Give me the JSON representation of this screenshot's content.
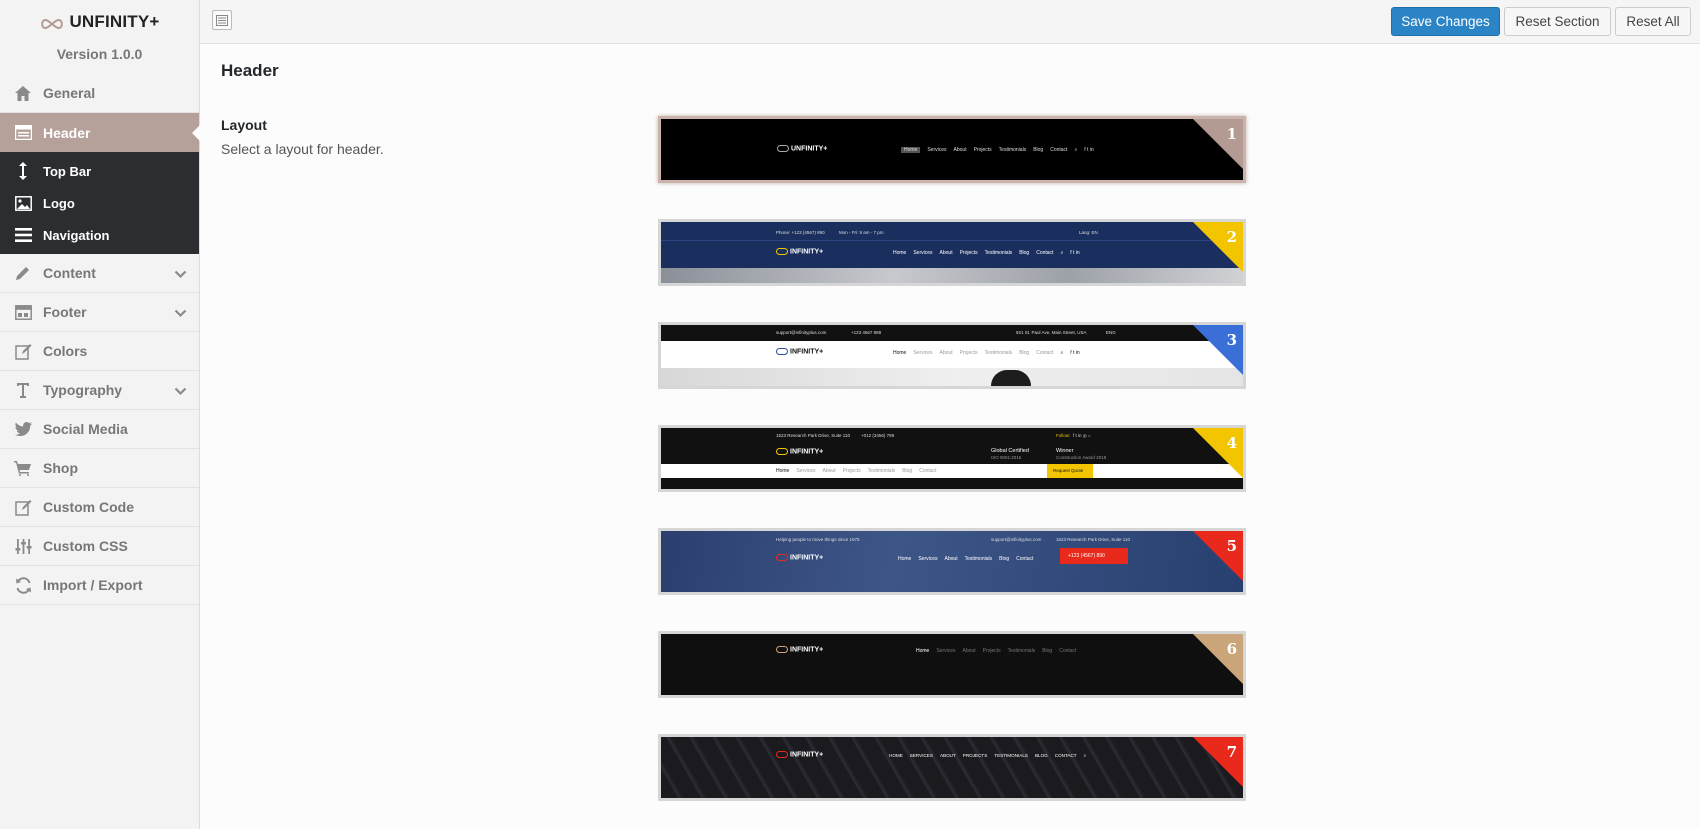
{
  "app": {
    "brand": "UNFINITY+",
    "version": "Version 1.0.0"
  },
  "sidebar": {
    "items": [
      {
        "label": "General",
        "icon": "home-icon"
      },
      {
        "label": "Header",
        "icon": "header-layout-icon",
        "active": true
      },
      {
        "label": "Content",
        "icon": "pencil-icon",
        "expandable": true
      },
      {
        "label": "Footer",
        "icon": "footer-layout-icon",
        "expandable": true
      },
      {
        "label": "Colors",
        "icon": "edit-square-icon"
      },
      {
        "label": "Typography",
        "icon": "text-icon",
        "expandable": true
      },
      {
        "label": "Social Media",
        "icon": "twitter-icon"
      },
      {
        "label": "Shop",
        "icon": "cart-icon"
      },
      {
        "label": "Custom Code",
        "icon": "edit-code-icon"
      },
      {
        "label": "Custom CSS",
        "icon": "sliders-icon"
      },
      {
        "label": "Import / Export",
        "icon": "refresh-icon"
      }
    ],
    "submenu": [
      {
        "label": "Top Bar",
        "icon": "vertical-arrows-icon"
      },
      {
        "label": "Logo",
        "icon": "image-icon"
      },
      {
        "label": "Navigation",
        "icon": "menu-lines-icon"
      }
    ]
  },
  "toolbar": {
    "save_label": "Save Changes",
    "reset_section_label": "Reset Section",
    "reset_all_label": "Reset All"
  },
  "section": {
    "title": "Header",
    "field_title": "Layout",
    "field_desc": "Select a layout for header."
  },
  "layouts": [
    {
      "number": "1",
      "corner_color": "#b39a92",
      "selected": true,
      "logo": "UNFINITY+",
      "nav": [
        "Home",
        "Services",
        "About",
        "Projects",
        "Testimonials",
        "Blog",
        "Contact"
      ]
    },
    {
      "number": "2",
      "corner_color": "#f2c500",
      "selected": false,
      "logo": "INFINITY+",
      "nav": [
        "Home",
        "Services",
        "About",
        "Projects",
        "Testimonials",
        "Blog",
        "Contact"
      ],
      "top_left": "Phone: +123 (4567) 890",
      "top_mid": "Mon - Fri: 9 am - 7 pm",
      "top_right": "Lang: EN"
    },
    {
      "number": "3",
      "corner_color": "#3a6fd8",
      "selected": false,
      "logo": "INFINITY+",
      "nav": [
        "Home",
        "Services",
        "About",
        "Projects",
        "Testimonials",
        "Blog",
        "Contact"
      ],
      "top_left": "support@infinityplus.com",
      "top_mid": "+123 4567 889",
      "top_right": "921 St. Paul Ave, Main Street, USA",
      "top_lang": "ENG"
    },
    {
      "number": "4",
      "corner_color": "#f2c500",
      "selected": false,
      "logo": "INFINITY+",
      "nav": [
        "Home",
        "Services",
        "About",
        "Projects",
        "Testimonials",
        "Blog",
        "Contact"
      ],
      "top_left": "1523 Research Park Drive, Suite 110",
      "top_mid": "+012 (3456) 789",
      "follow": "Follow:",
      "award1": "Global Certified",
      "award1_sub": "ISO 9001:2015",
      "award2": "Winner",
      "award2_sub": "Construction Award 2019",
      "cta": "Request Quote"
    },
    {
      "number": "5",
      "corner_color": "#e8291c",
      "selected": false,
      "logo": "INFINITY+",
      "nav": [
        "Home",
        "Services",
        "About",
        "Testimonials",
        "Blog",
        "Contact"
      ],
      "top_left": "Helping people to move things since 1975",
      "top_mid": "support@infinityplus.com",
      "top_right": "1523 Research Park Drive, Suite 110",
      "phone": "+123 (4567) 890"
    },
    {
      "number": "6",
      "corner_color": "#caa57a",
      "selected": false,
      "logo": "INFINITY+",
      "nav": [
        "Home",
        "Services",
        "About",
        "Projects",
        "Testimonials",
        "Blog",
        "Contact"
      ]
    },
    {
      "number": "7",
      "corner_color": "#e8291c",
      "selected": false,
      "logo": "INFINITY+",
      "nav": [
        "HOME",
        "SERVICES",
        "ABOUT",
        "PROJECTS",
        "TESTIMONIALS",
        "BLOG",
        "CONTACT"
      ]
    }
  ]
}
